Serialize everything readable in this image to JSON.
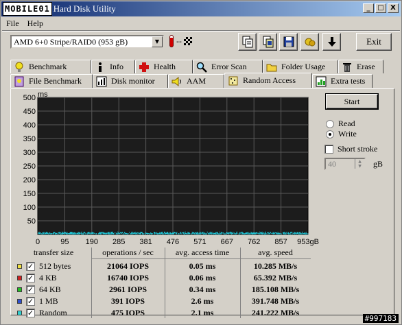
{
  "window": {
    "logo_text": "MOBILE01",
    "title": "Hard Disk Utility",
    "min_glyph": "_",
    "max_glyph": "□",
    "close_glyph": "X"
  },
  "menu": {
    "file": "File",
    "help": "Help"
  },
  "toolbar": {
    "drive": "AMD    6+0 Stripe/RAID0 (953 gB)",
    "dropdown_glyph": "▼",
    "temperature": "--",
    "exit": "Exit",
    "buttons": [
      "copy-text-icon",
      "copy-screen-icon",
      "save-icon",
      "options-icon",
      "download-icon"
    ]
  },
  "tabs": {
    "row_top": [
      "Benchmark",
      "Info",
      "Health",
      "Error Scan",
      "Folder Usage",
      "Erase"
    ],
    "row_bottom": [
      "File Benchmark",
      "Disk monitor",
      "AAM",
      "Random Access",
      "Extra tests"
    ],
    "active": "Random Access"
  },
  "controls": {
    "start": "Start",
    "read": "Read",
    "write": "Write",
    "mode_selected": "Write",
    "short_stroke": "Short stroke",
    "short_stroke_checked": false,
    "stroke_value": "40",
    "stroke_unit": "gB"
  },
  "chart_data": {
    "type": "scatter",
    "ylabel": "ms",
    "y_ticks": [
      "500",
      "450",
      "400",
      "350",
      "300",
      "250",
      "200",
      "150",
      "100",
      "50"
    ],
    "x_ticks": [
      "0",
      "95",
      "190",
      "285",
      "381",
      "476",
      "571",
      "667",
      "762",
      "857",
      "953gB"
    ],
    "xlim": [
      0,
      953
    ],
    "ylim": [
      0,
      500
    ],
    "grid": true,
    "background": "#1c1c1c",
    "series_color": "#20c8d8",
    "series": [
      {
        "name": "Random",
        "y_band": [
          1,
          8
        ],
        "xlim": [
          0,
          953
        ]
      }
    ]
  },
  "results": {
    "headers": [
      "transfer size",
      "operations / sec",
      "avg. access time",
      "avg. speed"
    ],
    "rows": [
      {
        "size": "512 bytes",
        "color": "#f0e040",
        "iops": "21064 IOPS",
        "access": "0.05 ms",
        "speed": "10.285 MB/s"
      },
      {
        "size": "4 KB",
        "color": "#d02020",
        "iops": "16740 IOPS",
        "access": "0.06 ms",
        "speed": "65.392 MB/s"
      },
      {
        "size": "64 KB",
        "color": "#20c020",
        "iops": "2961 IOPS",
        "access": "0.34 ms",
        "speed": "185.108 MB/s"
      },
      {
        "size": "1 MB",
        "color": "#3050d0",
        "iops": "391 IOPS",
        "access": "2.6 ms",
        "speed": "391.748 MB/s"
      },
      {
        "size": "Random",
        "color": "#30d0d0",
        "iops": "475 IOPS",
        "access": "2.1 ms",
        "speed": "241.222 MB/s"
      }
    ],
    "check_glyph": "✓"
  },
  "watermark": "#997183"
}
